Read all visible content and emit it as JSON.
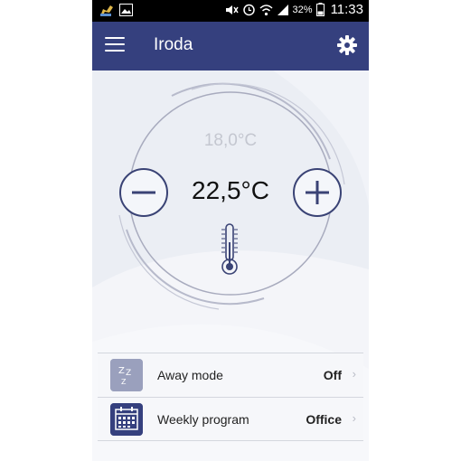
{
  "status_bar": {
    "battery_percent": "32%",
    "time": "11:33",
    "icons": [
      "notification-icon",
      "image-icon",
      "mute-icon",
      "alarm-icon",
      "wifi-icon",
      "signal-icon",
      "battery-icon"
    ]
  },
  "app_bar": {
    "title": "Iroda",
    "menu_icon": "menu-icon",
    "settings_icon": "gear-icon"
  },
  "thermostat": {
    "setpoint": "18,0°C",
    "current_temperature": "22,5°C",
    "decrease_icon": "minus-icon",
    "increase_icon": "plus-icon",
    "thermometer_icon": "thermometer-icon"
  },
  "list": {
    "items": [
      {
        "label": "Away mode",
        "value": "Off",
        "icon": "sleep-icon"
      },
      {
        "label": "Weekly program",
        "value": "Office",
        "icon": "calendar-icon"
      }
    ]
  },
  "colors": {
    "appbar": "#35407e",
    "accent_dark": "#3a4375",
    "background": "#ebeef4",
    "setpoint_text": "#c4c7d0"
  }
}
